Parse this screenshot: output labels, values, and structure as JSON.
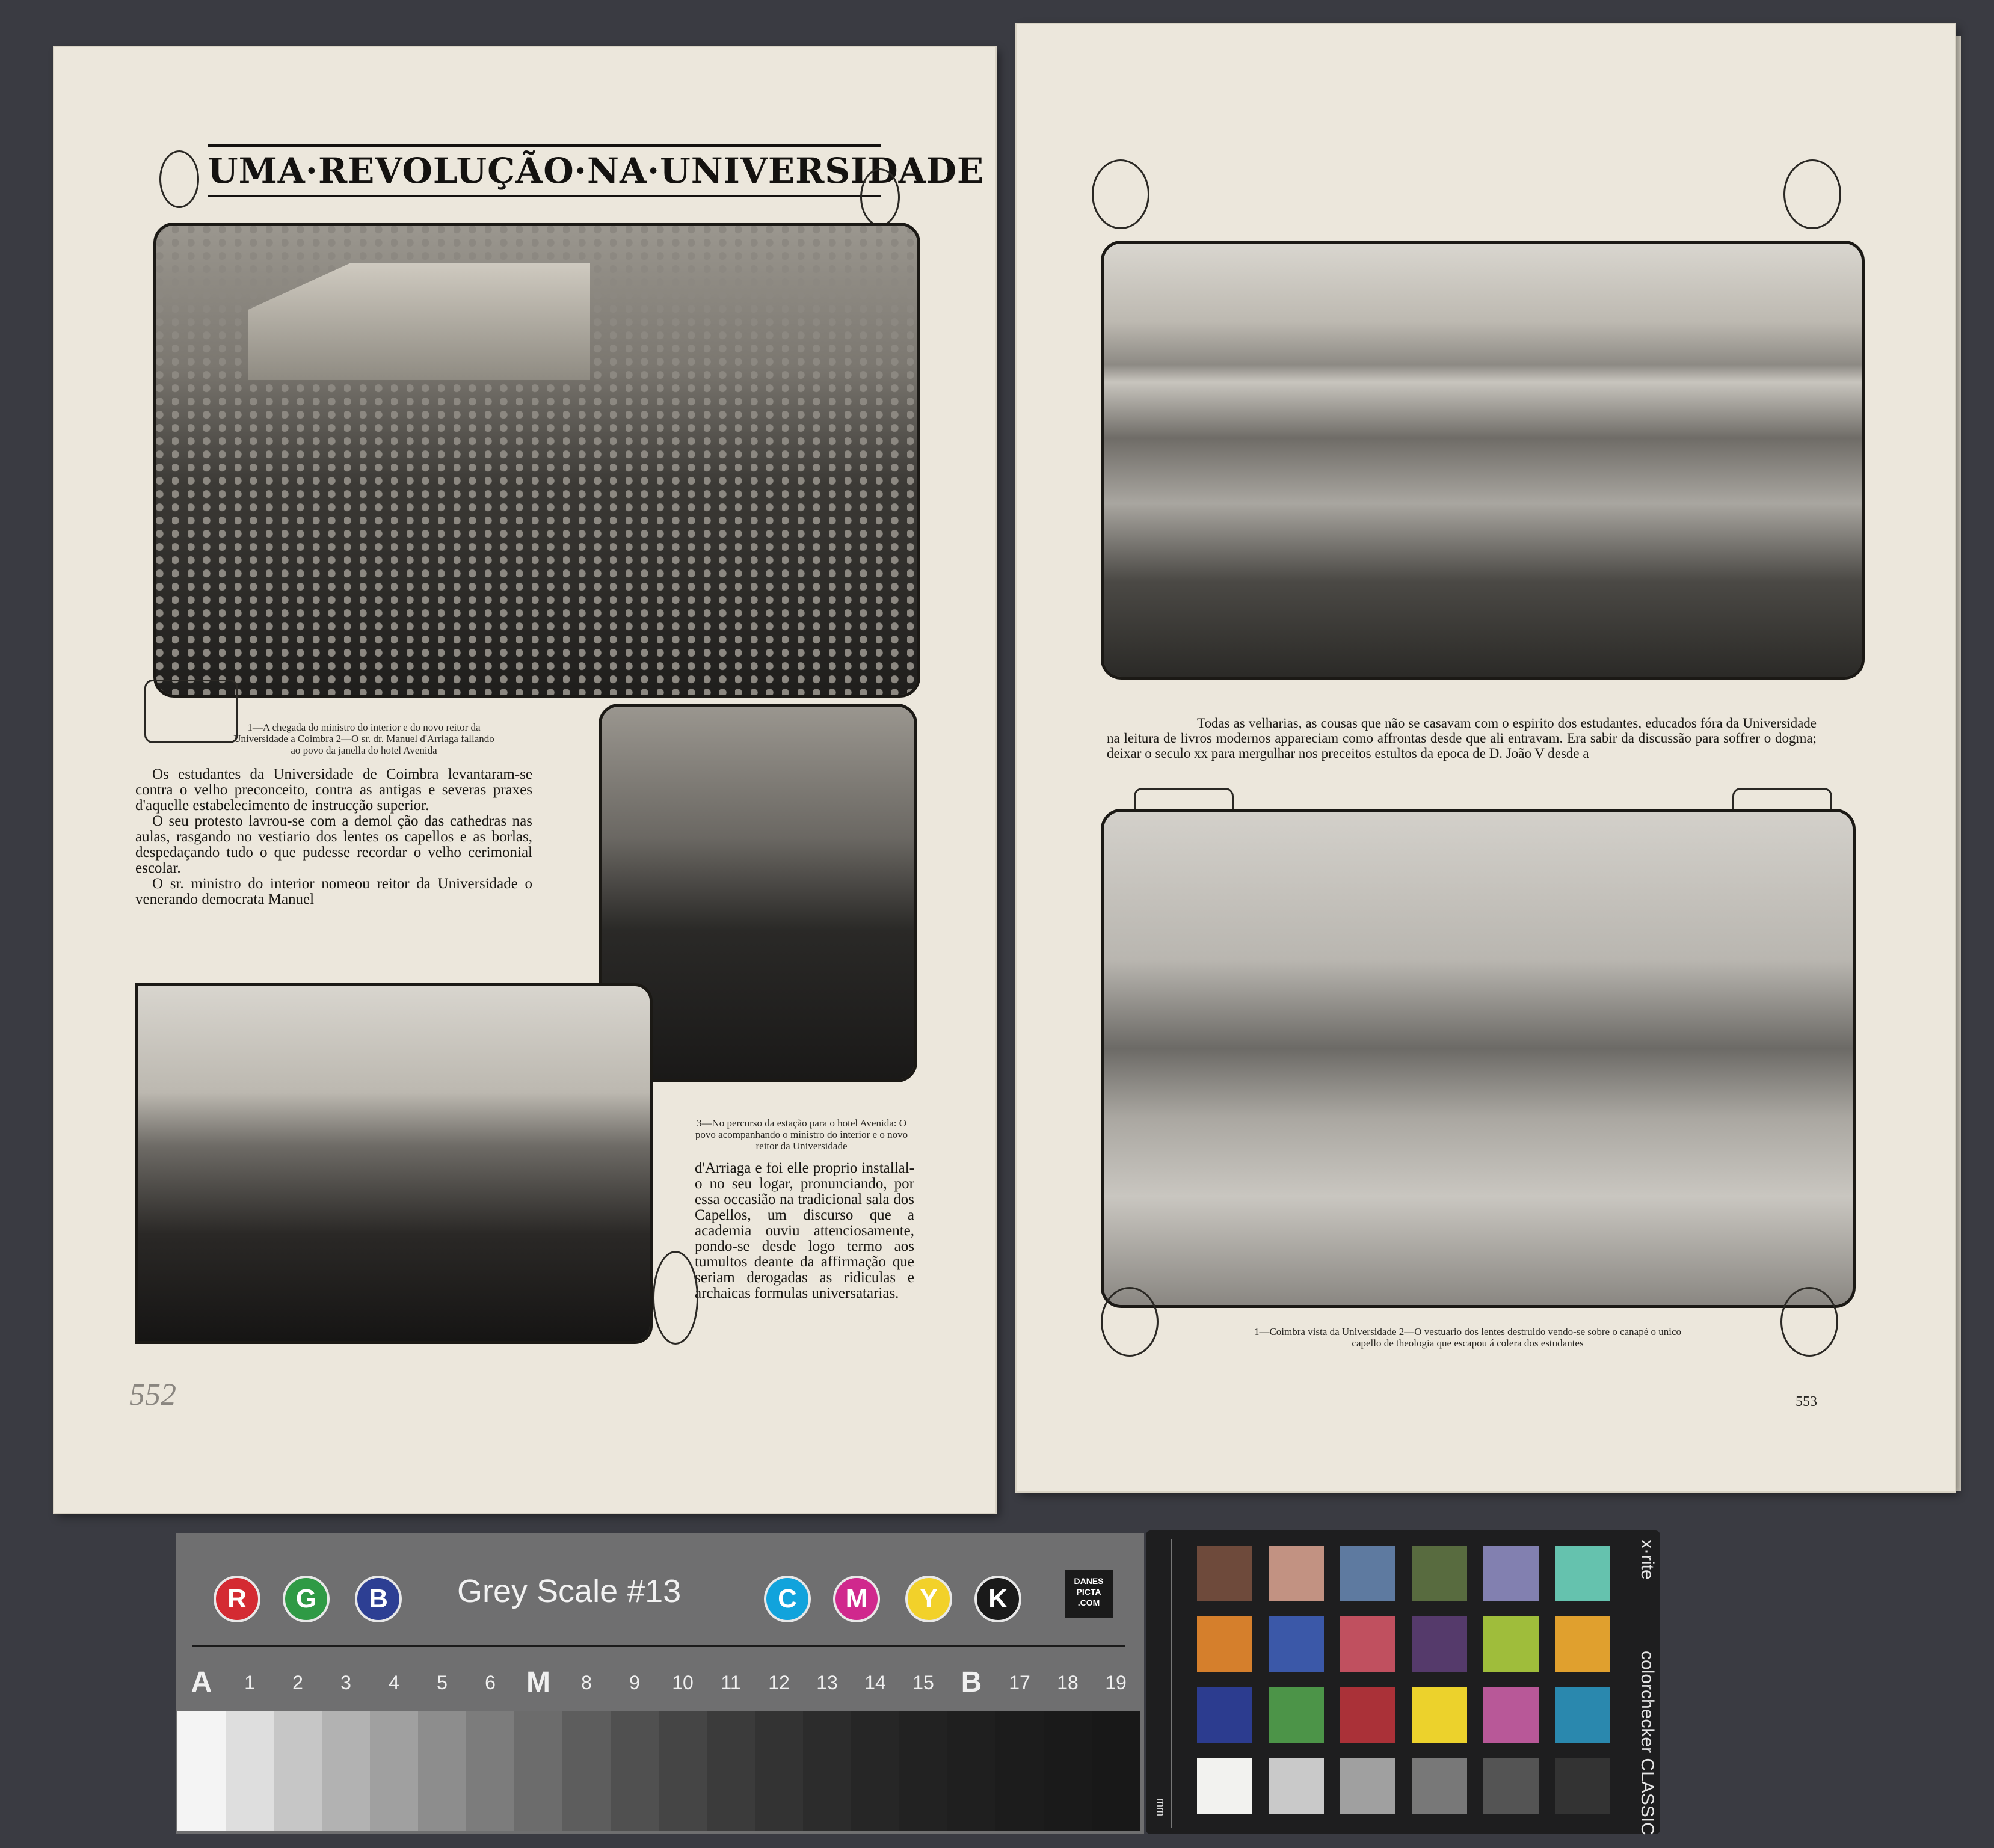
{
  "left_page": {
    "title": "UMA·REVOLUÇÃO·NA·UNIVERSIDADE",
    "caption_1": "1—A chegada do ministro do interior e do novo reitor da Universidade a Coimbra 2—O sr. dr. Manuel d'Arriaga fallando ao povo da janella do hotel Avenida",
    "caption_3": "3—No percurso da estação para o hotel Avenida: O povo acompanhando o ministro do interior e o novo reitor da Universidade",
    "paragraph_1": "Os estudantes da Universidade de Coimbra levantaram-se contra o velho preconceito, contra as antigas e severas praxes d'aquelle estabelecimento de instrucção superior.",
    "paragraph_2": "O seu protesto lavrou-se com a demol ção das cathedras nas aulas, rasgando no vestiario dos lentes os capellos e as borlas, despedaçando tudo o que pudesse recordar o velho cerimonial escolar.",
    "paragraph_3": "O sr. ministro do interior nomeou reitor da Universidade o venerando democrata Manuel",
    "paragraph_4": "d'Arriaga e foi elle proprio installal-o no seu logar, pronunciando, por essa occasião na tradicional sala dos Capellos, um discurso que a academia ouviu attenciosamente, pondo-se desde logo termo aos tumultos deante da affirmação que seriam derogadas as ridiculas e archaicas formulas universatarias.",
    "handwritten_page_number": "552"
  },
  "right_page": {
    "intro_text": "Todas as velharias, as cousas que não se casavam com o espirito dos estudantes, educados fóra da Universidade na leitura de livros modernos appareciam como affrontas desde que ali entravam. Era sabir da discussão para soffrer o dogma; deixar o seculo xx para mergulhar nos preceitos estultos da epoca de D. João V desde a",
    "caption": "1—Coimbra vista da Universidade 2—O vestuario dos lentes destruido vendo-se sobre o canapé o unico capello de theologia que escapou á colera dos estudantes",
    "page_number": "553"
  },
  "grey_scale_target": {
    "rgb": [
      "R",
      "G",
      "B"
    ],
    "cmyk": [
      "C",
      "M",
      "Y",
      "K"
    ],
    "title": "Grey Scale #13",
    "logo_text": "DANES PICTA .COM",
    "scale_labels": [
      "A",
      "1",
      "2",
      "3",
      "4",
      "5",
      "6",
      "M",
      "8",
      "9",
      "10",
      "11",
      "12",
      "13",
      "14",
      "15",
      "B",
      "17",
      "18",
      "19"
    ],
    "circle_colors": {
      "R": "#d42a32",
      "G": "#2f9a45",
      "B": "#2d3f93",
      "C": "#11a3dc",
      "M": "#d0288d",
      "Y": "#f2d12a",
      "K": "#1a1a1a"
    },
    "grey_steps": [
      "#f4f4f4",
      "#dedede",
      "#c6c6c6",
      "#b2b2b2",
      "#a0a0a0",
      "#8d8d8d",
      "#7c7c7c",
      "#6c6c6c",
      "#5d5d5d",
      "#505050",
      "#454545",
      "#3b3b3b",
      "#333333",
      "#2c2c2c",
      "#262626",
      "#222222",
      "#1f1f1f",
      "#1c1c1c",
      "#1a1a1a",
      "#181818"
    ]
  },
  "color_checker": {
    "brand": "x·rite",
    "product": "colorchecker CLASSIC",
    "ruler_unit": "mm",
    "patches": [
      "#6e4a3b",
      "#c29282",
      "#5e7aa0",
      "#586b3f",
      "#8280b0",
      "#65c2ae",
      "#d57f2c",
      "#3b58a8",
      "#c0505f",
      "#553a6b",
      "#9fbd3b",
      "#e0a02e",
      "#2c3c8f",
      "#4c9448",
      "#aa3138",
      "#ecd22c",
      "#b85898",
      "#2a88ae",
      "#f2f2ef",
      "#c9c9c9",
      "#a0a0a0",
      "#787878",
      "#545454",
      "#333333"
    ]
  }
}
